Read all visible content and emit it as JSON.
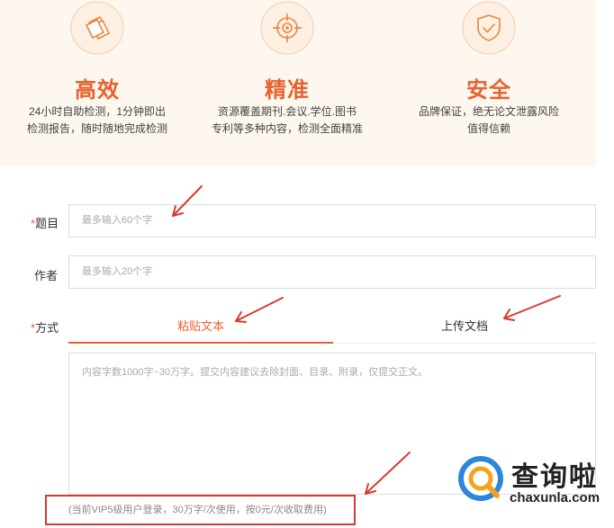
{
  "features": [
    {
      "icon": "documents-stack-icon",
      "title": "高效",
      "desc_lines": [
        "24小时自助检测，1分钟即出",
        "检测报告，随时随地完成检测"
      ]
    },
    {
      "icon": "crosshair-target-icon",
      "title": "精准",
      "desc_lines": [
        "资源覆盖期刊.会议.学位.图书",
        "专利等多种内容，检测全面精准"
      ]
    },
    {
      "icon": "shield-check-icon",
      "title": "安全",
      "desc_lines": [
        "品牌保证，绝无论文泄露风险",
        "值得信赖"
      ]
    }
  ],
  "form": {
    "title_label": "题目",
    "title_placeholder": "最多输入60个字",
    "author_label": "作者",
    "author_placeholder": "最多输入20个字",
    "method_label": "方式",
    "required_mark": "*",
    "tabs": [
      {
        "label": "粘贴文本",
        "active": true
      },
      {
        "label": "上传文档",
        "active": false
      }
    ],
    "content_placeholder": "内容字数1000字~30万字。提交内容建议去除封面、目录、附录，仅提交正文。",
    "notice": "(当前VIP5级用户登录，30万字/次使用，按0元/次收取费用)"
  },
  "watermark": {
    "text": "查询啦",
    "url": "chaxunla.com"
  },
  "colors": {
    "accent": "#e8612c",
    "banner_bg": "#fdf7ef",
    "annotation_red": "#d63b2f"
  }
}
